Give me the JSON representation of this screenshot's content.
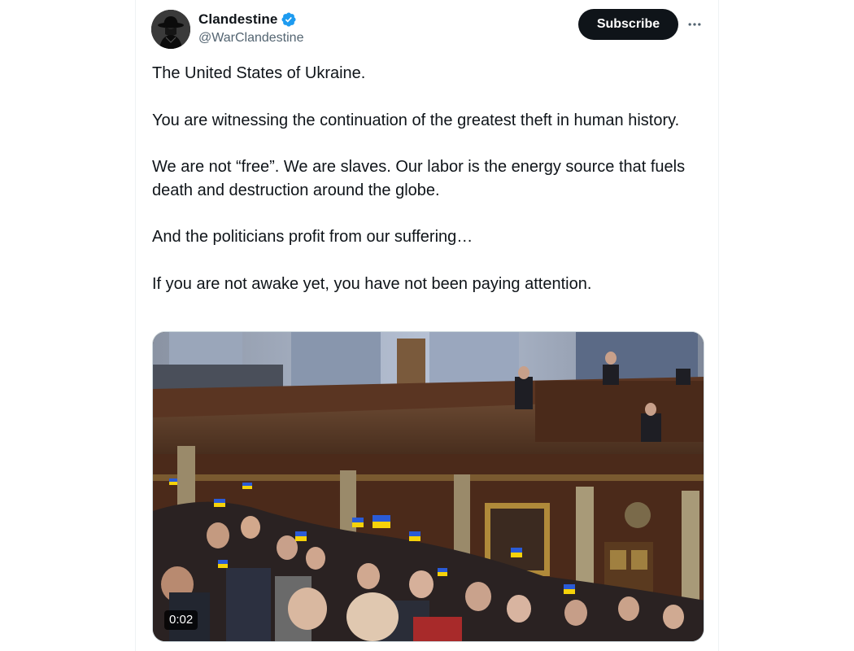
{
  "author": {
    "display_name": "Clandestine",
    "handle": "@WarClandestine",
    "verified": true,
    "avatar_icon": "avatar-hat-silhouette-icon"
  },
  "actions": {
    "subscribe_label": "Subscribe",
    "more_icon": "more-horizontal-icon"
  },
  "tweet": {
    "paragraphs": [
      "The United States of Ukraine.",
      "You are witnessing the continuation of the greatest theft in human history.",
      "We are not “free”. We are slaves. Our labor is the energy source that fuels death and destruction around the globe.",
      "And the politicians profit from our suffering…",
      "If you are not awake yet, you have not been paying attention."
    ]
  },
  "media": {
    "type": "video",
    "duration": "0:02"
  },
  "colors": {
    "text": "#0f1419",
    "secondary": "#536471",
    "verified_blue": "#1d9bf0",
    "button_bg": "#0f1419",
    "border": "#eff3f4"
  }
}
